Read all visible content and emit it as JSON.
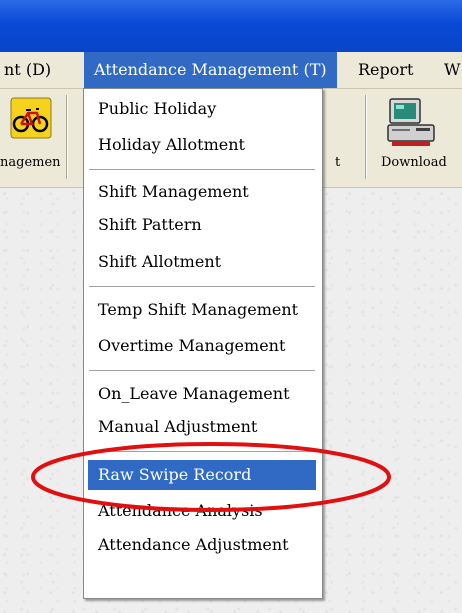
{
  "menubar": {
    "items": [
      {
        "label": "nt (D)"
      },
      {
        "label": "Attendance Management (T)"
      },
      {
        "label": "Report"
      },
      {
        "label": "W"
      }
    ]
  },
  "toolbar": {
    "buttons": [
      {
        "label": "nagemen",
        "icon": "bicycle-icon"
      },
      {
        "label": "t"
      },
      {
        "label": "Download",
        "icon": "computer-download-icon"
      }
    ]
  },
  "dropdown": {
    "groups": [
      [
        "Public Holiday",
        "Holiday Allotment"
      ],
      [
        "Shift Management",
        "Shift Pattern",
        "Shift Allotment"
      ],
      [
        "Temp Shift Management",
        "Overtime Management"
      ],
      [
        "On_Leave Management",
        "Manual Adjustment"
      ],
      [
        "Raw Swipe Record",
        "Attendance Analysis",
        "Attendance Adjustment"
      ]
    ],
    "selected": "Raw Swipe Record"
  },
  "annotation": {
    "color": "#e01010",
    "shape": "ellipse"
  }
}
